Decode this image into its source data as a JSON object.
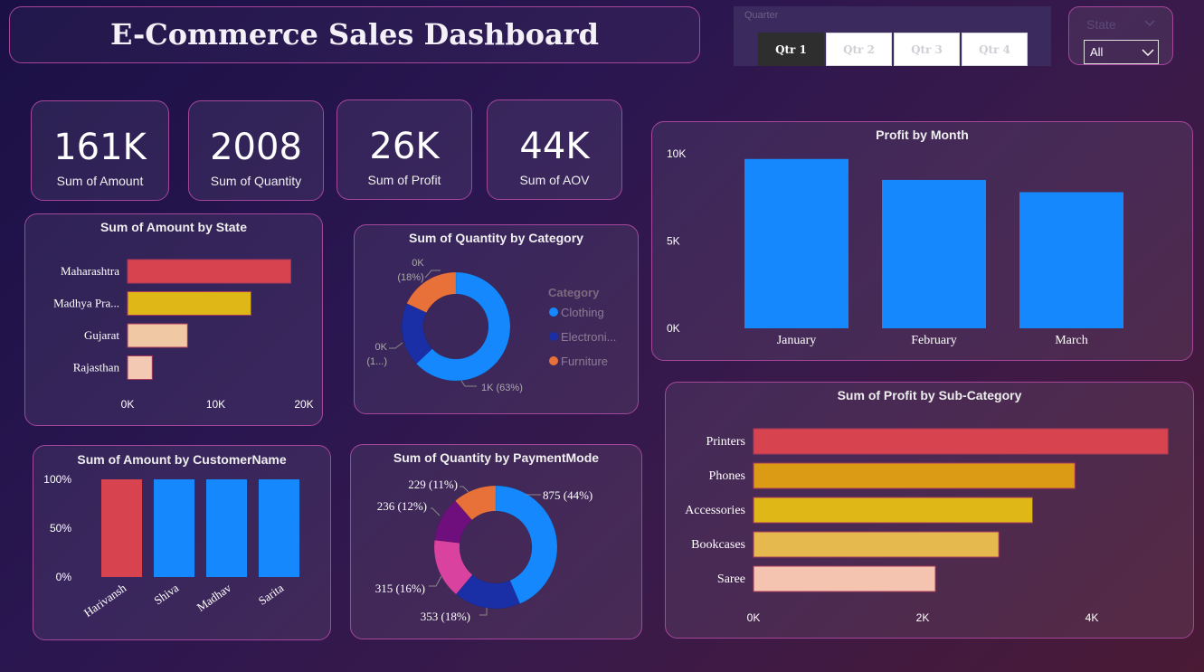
{
  "header": {
    "title": "E-Commerce Sales Dashboard"
  },
  "quarter_slicer": {
    "label": "Quarter",
    "buttons": [
      "Qtr 1",
      "Qtr 2",
      "Qtr 3",
      "Qtr 4"
    ],
    "selected": "Qtr 1"
  },
  "state_slicer": {
    "label": "State",
    "value": "All"
  },
  "kpis": [
    {
      "value": "161K",
      "caption": "Sum of Amount"
    },
    {
      "value": "2008",
      "caption": "Sum of Quantity"
    },
    {
      "value": "26K",
      "caption": "Sum of Profit"
    },
    {
      "value": "44K",
      "caption": "Sum of AOV"
    }
  ],
  "colors": {
    "blue": "#1488fc",
    "red": "#d7434f",
    "gold": "#dfb717",
    "orange": "#db9b14",
    "peach": "#f0c8a4",
    "navy": "#1a2fa5",
    "carrot": "#e8713a",
    "purple": "#6f0f7e",
    "pink": "#d9439f"
  },
  "chart_data": [
    {
      "id": "state",
      "type": "bar",
      "orientation": "horizontal",
      "title": "Sum of Amount by State",
      "categories": [
        "Maharashtra",
        "Madhya Pra...",
        "Gujarat",
        "Rajasthan"
      ],
      "values": [
        18500,
        14000,
        6800,
        2800
      ],
      "xlim": [
        0,
        20000
      ],
      "xticks": [
        "0K",
        "10K",
        "20K"
      ],
      "colors": [
        "#d7434f",
        "#dfb717",
        "#f0c8a4",
        "#f4c9b4"
      ]
    },
    {
      "id": "category",
      "type": "pie",
      "donut": true,
      "title": "Sum of Quantity by Category",
      "legend_title": "Category",
      "categories": [
        "Clothing",
        "Electronics",
        "Furniture"
      ],
      "legend_labels": [
        "Clothing",
        "Electroni...",
        "Furniture"
      ],
      "values": [
        63,
        19,
        18
      ],
      "labels": [
        "1K (63%)",
        "0K (1...)",
        "0K (18%)"
      ],
      "colors": [
        "#1488fc",
        "#1a2fa5",
        "#e8713a"
      ]
    },
    {
      "id": "month",
      "type": "bar",
      "title": "Profit by Month",
      "categories": [
        "January",
        "February",
        "March"
      ],
      "values": [
        9700,
        8500,
        7800
      ],
      "ylim": [
        0,
        10000
      ],
      "yticks": [
        "0K",
        "5K",
        "10K"
      ],
      "colors": [
        "#1488fc"
      ]
    },
    {
      "id": "customer",
      "type": "bar",
      "title": "Sum of Amount by CustomerName",
      "categories": [
        "Harivansh",
        "Shiva",
        "Madhav",
        "Sarita"
      ],
      "values": [
        100,
        100,
        100,
        100
      ],
      "ylim": [
        0,
        100
      ],
      "yticks": [
        "0%",
        "50%",
        "100%"
      ],
      "colors": [
        "#d7434f",
        "#1488fc",
        "#1488fc",
        "#1488fc"
      ]
    },
    {
      "id": "payment",
      "type": "pie",
      "donut": true,
      "title": "Sum of Quantity by PaymentMode",
      "values": [
        875,
        353,
        315,
        236,
        229
      ],
      "labels": [
        "875 (44%)",
        "353 (18%)",
        "315 (16%)",
        "236 (12%)",
        "229 (11%)"
      ],
      "colors": [
        "#1488fc",
        "#1a2fa5",
        "#d9439f",
        "#6f0f7e",
        "#e8713a"
      ]
    },
    {
      "id": "subcat",
      "type": "bar",
      "orientation": "horizontal",
      "title": "Sum of Profit by Sub-Category",
      "categories": [
        "Printers",
        "Phones",
        "Accessories",
        "Bookcases",
        "Saree"
      ],
      "values": [
        4900,
        3800,
        3300,
        2900,
        2150
      ],
      "xlim": [
        0,
        4000
      ],
      "xticks": [
        "0K",
        "2K",
        "4K"
      ],
      "colors": [
        "#d7434f",
        "#db9b14",
        "#dfb717",
        "#e5b94e",
        "#f4c4b0"
      ]
    }
  ]
}
